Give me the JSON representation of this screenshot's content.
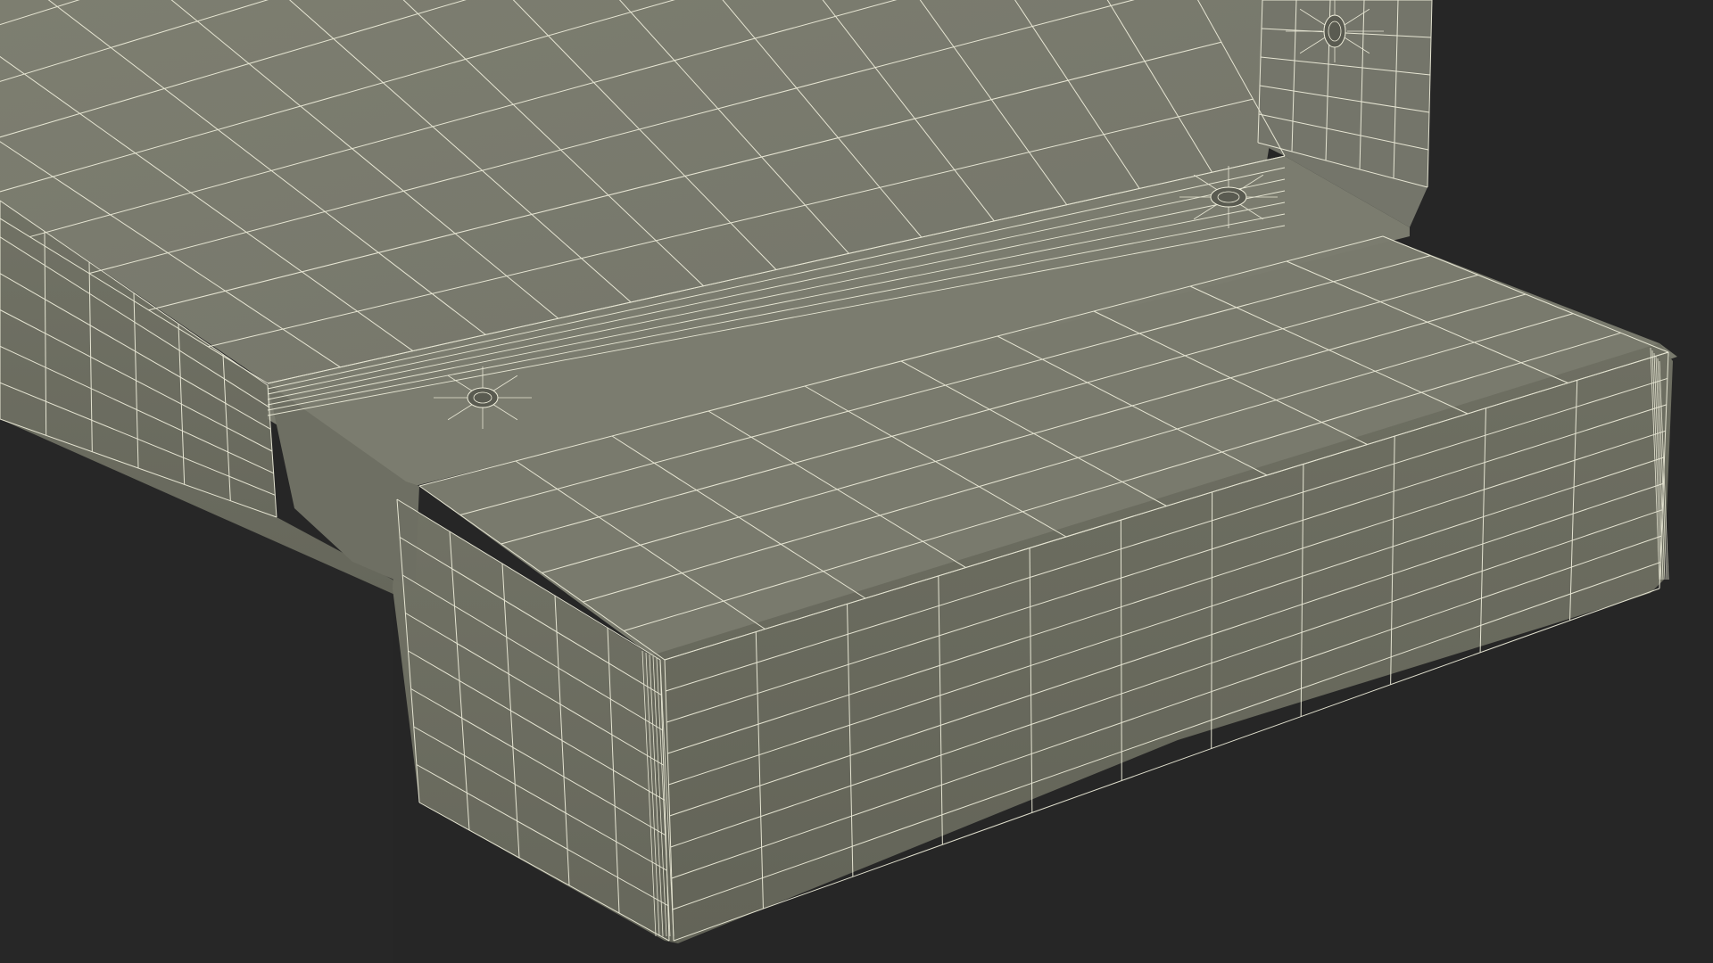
{
  "scene": {
    "subject": "wireframe-render",
    "colors": {
      "background": "#262626",
      "surface_top": "#7a7b6d",
      "surface_side": "#6d6e61",
      "surface_dark": "#5f6055",
      "wire": "#f0efdc",
      "bracket": "#75766a"
    },
    "icons": [
      "screw-hole-icon",
      "screw-hole-icon",
      "screw-hole-icon"
    ]
  }
}
